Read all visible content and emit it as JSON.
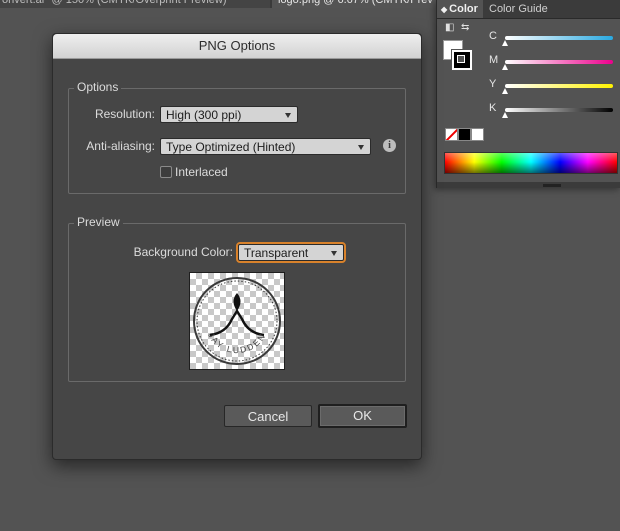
{
  "doc_tabs": [
    {
      "label": "onvert.ai* @ 150% (CMYK/Overprint Preview)"
    },
    {
      "label": "logo.png @ 6.67% (CMYK/Prev"
    }
  ],
  "color_panel": {
    "tabs": [
      {
        "label": "Color",
        "active": true
      },
      {
        "label": "Color Guide",
        "active": false
      }
    ],
    "sliders": [
      {
        "label": "C",
        "color": "#29a9e1",
        "value": 0
      },
      {
        "label": "M",
        "color": "#ec008c",
        "value": 0
      },
      {
        "label": "Y",
        "color": "#fff200",
        "value": 0
      },
      {
        "label": "K",
        "color": "#000000",
        "value": 0
      }
    ]
  },
  "dialog": {
    "title": "PNG Options",
    "options_group": {
      "title": "Options",
      "resolution_label": "Resolution:",
      "resolution_value": "High (300 ppi)",
      "antialiasing_label": "Anti-aliasing:",
      "antialiasing_value": "Type Optimized (Hinted)",
      "interlaced_label": "Interlaced",
      "interlaced_checked": false
    },
    "preview_group": {
      "title": "Preview",
      "bg_color_label": "Background Color:",
      "bg_color_value": "Transparent",
      "logo_text": "JAY LUDDEN"
    },
    "cancel_label": "Cancel",
    "ok_label": "OK"
  },
  "colors": {
    "accent_focus": "#d9822b",
    "dialog_bg": "#464646",
    "app_bg": "#535353"
  }
}
